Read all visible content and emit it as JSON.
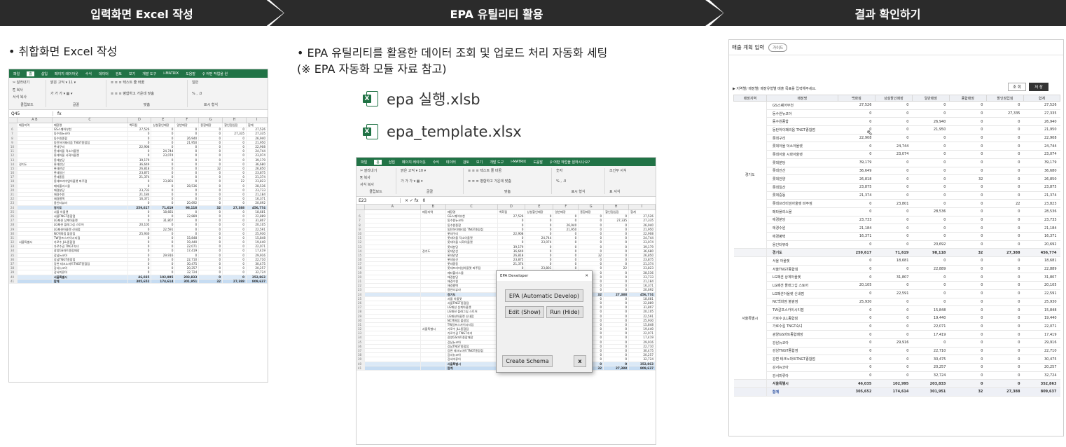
{
  "steps": [
    {
      "label": "입력화면 Excel 작성"
    },
    {
      "label": "EPA 유틸리티 활용"
    },
    {
      "label": "결과 확인하기"
    }
  ],
  "left": {
    "bullet": "• 취합화면 Excel 작성",
    "excel": {
      "menu": [
        "파일",
        "홈",
        "삽입",
        "페이지 레이아웃",
        "수식",
        "데이터",
        "검토",
        "보기",
        "개발 도구",
        "i-MATRIX",
        "도움말",
        "♀ 어떤 작업을 원"
      ],
      "namebox": "Q45",
      "fx": "fx",
      "headers": [
        "매장지역",
        "매장명",
        "백화점",
        "상설할인매장",
        "일반매장",
        "종합매장",
        "할인점입점",
        "합계"
      ]
    }
  },
  "middle": {
    "bullet_line1": "• EPA 유틸리티를 활용한 데이터 조회 및 업로드 처리 자동화 세팅",
    "bullet_line2": "(※ EPA 자동화 모듈 자료 참고)",
    "files": [
      "epa 실행.xlsb",
      "epa_template.xlsx"
    ],
    "excel": {
      "menu": [
        "파일",
        "홈",
        "삽입",
        "페이지 레이아웃",
        "수식",
        "데이터",
        "검토",
        "보기",
        "개발 도구",
        "i-MATRIX",
        "도움말",
        "♀ 어떤 작업을 원하시나요?"
      ],
      "namebox": "E23",
      "formula": "0"
    },
    "dialog": {
      "title": "EPA Developer",
      "close": "✕",
      "btn_develop": "EPA (Automatic Develop)",
      "btn_edit": "Edit (Show)",
      "btn_run": "Run (Hide)",
      "btn_schema": "Create Schema",
      "btn_x": "x"
    }
  },
  "right": {
    "title": "매출 계획 입력",
    "guide": "가이드",
    "instruction": "▶ 지역별/ 매장별/ 매장유형별 매출 목표를 입력해주세요.",
    "btn_search": "조 회",
    "btn_save": "저 장",
    "columns": [
      "매장지역",
      "매장명",
      "백화점",
      "상설할인매장",
      "일반매장",
      "종합매장",
      "할인점입점",
      "합계"
    ],
    "region1": "경기도",
    "region2": "서울특별시",
    "rows1": [
      [
        "GS스퀘어부천",
        "27,526",
        "0",
        "0",
        "0",
        "0",
        "27,526"
      ],
      [
        "동수원뉴코아",
        "0",
        "0",
        "0",
        "0",
        "27,335",
        "27,335"
      ],
      [
        "동수원종합",
        "0",
        "0",
        "26,940",
        "0",
        "0",
        "26,940"
      ],
      [
        "동탄하이패리움 TNGT종합점",
        "0",
        "0",
        "21,950",
        "0",
        "0",
        "21,950"
      ],
      [
        "롯데구리",
        "22,908",
        "0",
        "0",
        "0",
        "0",
        "22,908"
      ],
      [
        "롯데아울 덕소아울렛",
        "0",
        "24,744",
        "0",
        "0",
        "0",
        "24,744"
      ],
      [
        "롯데아울 시화아울렛",
        "0",
        "23,074",
        "0",
        "0",
        "0",
        "23,074"
      ],
      [
        "롯데분당",
        "39,179",
        "0",
        "0",
        "0",
        "0",
        "39,179"
      ],
      [
        "롯데안산",
        "36,649",
        "0",
        "0",
        "0",
        "0",
        "36,680"
      ],
      [
        "롯데안양",
        "26,818",
        "0",
        "0",
        "32",
        "0",
        "26,850"
      ],
      [
        "롯데일산",
        "23,875",
        "0",
        "0",
        "0",
        "0",
        "23,875"
      ],
      [
        "롯데중동",
        "21,374",
        "0",
        "0",
        "0",
        "0",
        "21,374"
      ],
      [
        "롯데프리미엄아울렛 파주점",
        "0",
        "23,801",
        "0",
        "0",
        "22",
        "23,823"
      ],
      [
        "메타폴리스몰",
        "0",
        "0",
        "28,536",
        "0",
        "0",
        "28,536"
      ],
      [
        "애경분당",
        "23,733",
        "0",
        "0",
        "0",
        "0",
        "23,733"
      ],
      [
        "애경수원",
        "21,184",
        "0",
        "0",
        "0",
        "0",
        "21,184"
      ],
      [
        "애경평택",
        "16,371",
        "0",
        "0",
        "0",
        "0",
        "16,371"
      ],
      [
        "용인터뷰라",
        "0",
        "0",
        "20,692",
        "0",
        "0",
        "20,692"
      ]
    ],
    "sub1": [
      "경기도",
      "259,617",
      "71,619",
      "98,118",
      "32",
      "27,388",
      "456,774"
    ],
    "rows2": [
      [
        "서울 아울렛",
        "0",
        "18,681",
        "0",
        "0",
        "0",
        "18,681"
      ],
      [
        "서울TNGT종합점",
        "0",
        "0",
        "22,889",
        "0",
        "0",
        "22,889"
      ],
      [
        "LG패션 상계아울렛",
        "0",
        "31,807",
        "0",
        "0",
        "0",
        "31,807"
      ],
      [
        "LG패션 플래그십 스토어",
        "20,105",
        "0",
        "0",
        "0",
        "0",
        "20,105"
      ],
      [
        "LG패션아울렛 신내점",
        "0",
        "22,591",
        "0",
        "0",
        "0",
        "22,591"
      ],
      [
        "NC백화점 불광점",
        "25,930",
        "0",
        "0",
        "0",
        "0",
        "25,930"
      ],
      [
        "TW갈프스카이시티점",
        "0",
        "0",
        "15,848",
        "0",
        "0",
        "15,848"
      ],
      [
        "가로수 JLL종합점",
        "0",
        "0",
        "19,440",
        "0",
        "0",
        "19,440"
      ],
      [
        "가로수길 TNGT숙녀",
        "0",
        "0",
        "22,071",
        "0",
        "0",
        "22,071"
      ],
      [
        "광양GS마트종합매장",
        "0",
        "0",
        "17,419",
        "0",
        "0",
        "17,419"
      ],
      [
        "강남뉴코아",
        "0",
        "29,916",
        "0",
        "0",
        "0",
        "29,916"
      ],
      [
        "강남TNGT종합점",
        "0",
        "0",
        "22,710",
        "0",
        "0",
        "22,710"
      ],
      [
        "강변 테크노마트TNGT종합점",
        "0",
        "0",
        "30,475",
        "0",
        "0",
        "30,475"
      ],
      [
        "강서뉴코아",
        "0",
        "0",
        "20,257",
        "0",
        "0",
        "20,257"
      ],
      [
        "강서미류아",
        "0",
        "0",
        "32,724",
        "0",
        "0",
        "32,724"
      ]
    ],
    "sub2": [
      "서울특별시",
      "46,035",
      "102,995",
      "203,833",
      "0",
      "0",
      "352,863"
    ],
    "total": [
      "합계",
      "305,652",
      "174,614",
      "301,951",
      "32",
      "27,388",
      "809,637"
    ]
  }
}
